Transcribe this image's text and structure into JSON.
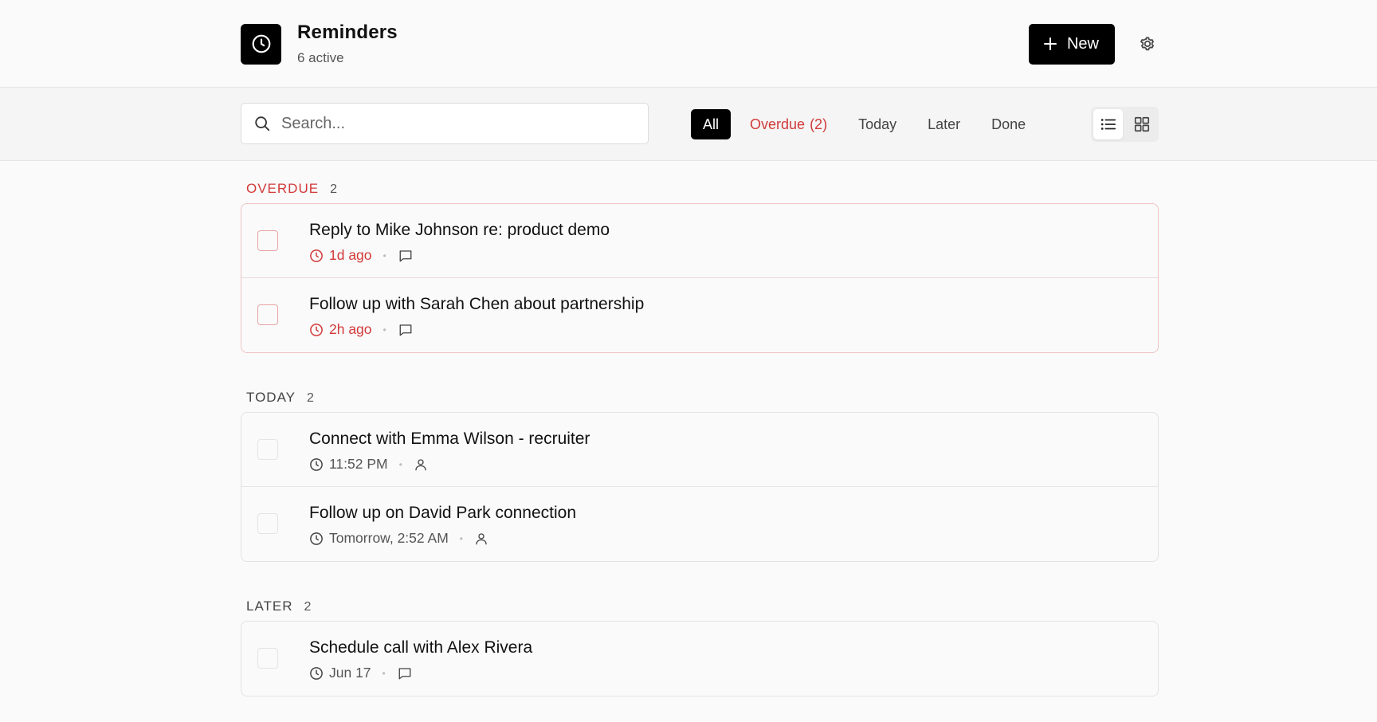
{
  "header": {
    "title": "Reminders",
    "subtitle": "6 active",
    "new_label": "New"
  },
  "toolbar": {
    "search_placeholder": "Search...",
    "filters": [
      {
        "label": "All"
      },
      {
        "label": "Overdue",
        "count": "(2)"
      },
      {
        "label": "Today"
      },
      {
        "label": "Later"
      },
      {
        "label": "Done"
      }
    ]
  },
  "colors": {
    "accent": "#000000",
    "overdue": "#d23a3a"
  },
  "sections": [
    {
      "name": "OVERDUE",
      "count": "2",
      "items": [
        {
          "title": "Reply to Mike Johnson re: product demo",
          "time": "1d ago",
          "icon": "message-icon"
        },
        {
          "title": "Follow up with Sarah Chen about partnership",
          "time": "2h ago",
          "icon": "message-icon"
        }
      ]
    },
    {
      "name": "TODAY",
      "count": "2",
      "items": [
        {
          "title": "Connect with Emma Wilson - recruiter",
          "time": "11:52 PM",
          "icon": "user-icon"
        },
        {
          "title": "Follow up on David Park connection",
          "time": "Tomorrow, 2:52 AM",
          "icon": "user-icon"
        }
      ]
    },
    {
      "name": "LATER",
      "count": "2",
      "items": [
        {
          "title": "Schedule call with Alex Rivera",
          "time": "Jun 17",
          "icon": "message-icon"
        }
      ]
    }
  ]
}
